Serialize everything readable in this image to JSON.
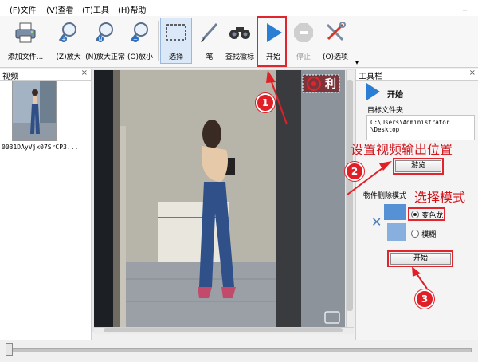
{
  "menu": {
    "file": "(F)文件",
    "view": "(V)查看",
    "tools": "(T)工具",
    "help": "(H)帮助"
  },
  "toolbar": {
    "add_file": "添加文件...",
    "zoom_in": "(Z)放大",
    "zoom_normal": "(N)放大正常",
    "zoom_out": "(O)放小",
    "select": "选择",
    "pen": "笔",
    "find_logo": "查找徽标",
    "start": "开始",
    "stop": "停止",
    "options": "(O)选项"
  },
  "video_panel": {
    "title": "视频",
    "close": "×",
    "thumbnail_name": "0031DAyVjx07SrCP3..."
  },
  "tool_panel": {
    "title": "工具栏",
    "close": "×",
    "header_label": "开始",
    "target_folder_label": "目标文件夹",
    "target_folder_path_line1": "C:\\Users\\Administrator",
    "target_folder_path_line2": "\\Desktop",
    "browse_button": "游览",
    "removal_mode_label": "物件删除模式",
    "mode_options": [
      {
        "label": "变色龙",
        "selected": true
      },
      {
        "label": "模糊",
        "selected": false
      }
    ],
    "start_button": "开始"
  },
  "video_overlay": {
    "watermark_text": "利"
  },
  "annotations": {
    "step1": "1",
    "step2": "2",
    "step3": "3",
    "set_output": "设置视频输出位置",
    "choose_mode": "选择模式"
  },
  "colors": {
    "annotation_red": "#e11f26",
    "start_blue": "#2a7fd4"
  }
}
